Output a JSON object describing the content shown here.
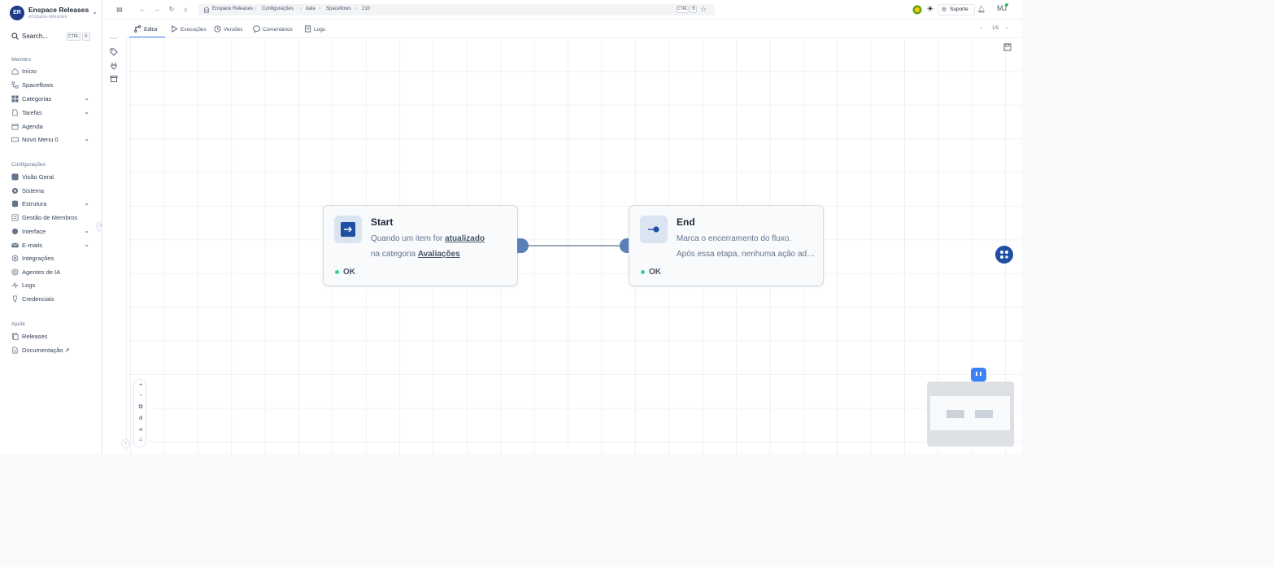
{
  "workspace": {
    "name": "Enspace Releases",
    "subtitle": "enspace-releases",
    "avatar_text": "ER"
  },
  "search": {
    "label": "Search...",
    "shortcut_key1": "CTRL",
    "shortcut_key2": "K"
  },
  "sidebar": {
    "section_member": "Membro",
    "member_items": [
      {
        "label": "Início"
      },
      {
        "label": "Spaceflows"
      },
      {
        "label": "Categorias"
      },
      {
        "label": "Tarefas"
      },
      {
        "label": "Agenda"
      },
      {
        "label": "Novo Menu 0"
      }
    ],
    "section_config": "Configurações",
    "config_items": [
      {
        "label": "Visão Geral"
      },
      {
        "label": "Sistema"
      },
      {
        "label": "Estrutura"
      },
      {
        "label": "Gestão de Membros"
      },
      {
        "label": "Interface"
      },
      {
        "label": "E-mails"
      },
      {
        "label": "Integrações"
      },
      {
        "label": "Agentes de IA"
      },
      {
        "label": "Logs"
      },
      {
        "label": "Credenciais"
      }
    ],
    "section_help": "Ajuda",
    "help_items": [
      {
        "label": "Releases"
      },
      {
        "label": "Documentação ↗"
      }
    ]
  },
  "breadcrumbs": [
    "Enspace Releases",
    "Configurações",
    "data",
    "Spaceflows",
    "210"
  ],
  "breadcrumb_shortcut": {
    "key1": "CTRL",
    "key2": "B"
  },
  "topbar": {
    "support_label": "Suporte",
    "user_initials": "MJ"
  },
  "tabs": [
    {
      "label": "Editor",
      "active": true
    },
    {
      "label": "Execuções"
    },
    {
      "label": "Versões"
    },
    {
      "label": "Comentários"
    },
    {
      "label": "Logs"
    }
  ],
  "pager": {
    "text": "1/5"
  },
  "nodes": {
    "start": {
      "title": "Start",
      "desc_prefix": "Quando um item for ",
      "desc_bold1": "atualizado",
      "desc_mid": "na categoria ",
      "desc_bold2": "Avaliações",
      "status": "OK"
    },
    "end": {
      "title": "End",
      "desc_line1": "Marca o encerramento do fluxo.",
      "desc_line2": "Após essa etapa, nenhuma ação adicional será executada.",
      "status": "OK"
    }
  },
  "zoom_controls": [
    "+",
    "−",
    "⧉",
    "⋔",
    "⋖",
    "⌂"
  ],
  "colors": {
    "accent": "#3b82f6",
    "node_handle": "#5b7fb8",
    "status_ok": "#34d399",
    "fab": "#1e4fa3"
  }
}
